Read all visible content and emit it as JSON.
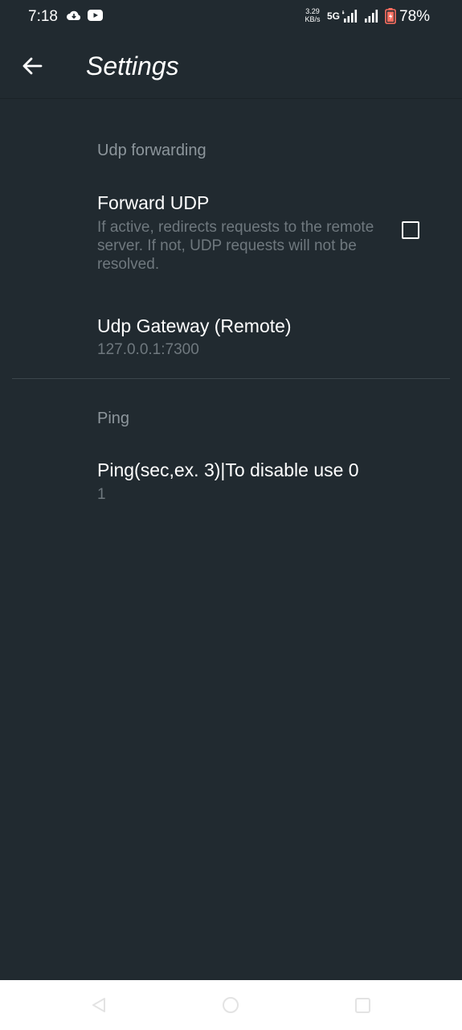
{
  "status_bar": {
    "time": "7:18",
    "speed_value": "3.29",
    "speed_unit": "KB/s",
    "network": "5G",
    "battery": "78%",
    "icons": [
      "cloud-icon",
      "youtube-icon",
      "signal-icon",
      "signal-icon",
      "battery-icon"
    ]
  },
  "app_bar": {
    "title": "Settings",
    "back_icon": "arrow-left-icon"
  },
  "sections": {
    "udp": {
      "header": "Udp forwarding",
      "forward_udp": {
        "title": "Forward UDP",
        "summary": "If active, redirects requests to the remote server. If not, UDP requests will not be resolved.",
        "checked": false
      },
      "gateway": {
        "title": "Udp Gateway (Remote)",
        "value": "127.0.0.1:7300"
      }
    },
    "ping": {
      "header": "Ping",
      "ping_interval": {
        "title": "Ping(sec,ex. 3)|To disable use 0",
        "value": "1"
      }
    }
  },
  "nav_bar": {
    "icons": [
      "nav-back-icon",
      "nav-home-icon",
      "nav-recents-icon"
    ]
  },
  "colors": {
    "background": "#212a30",
    "section_header": "#8d969c",
    "summary": "#6f787e",
    "battery": "#ff6f61"
  }
}
